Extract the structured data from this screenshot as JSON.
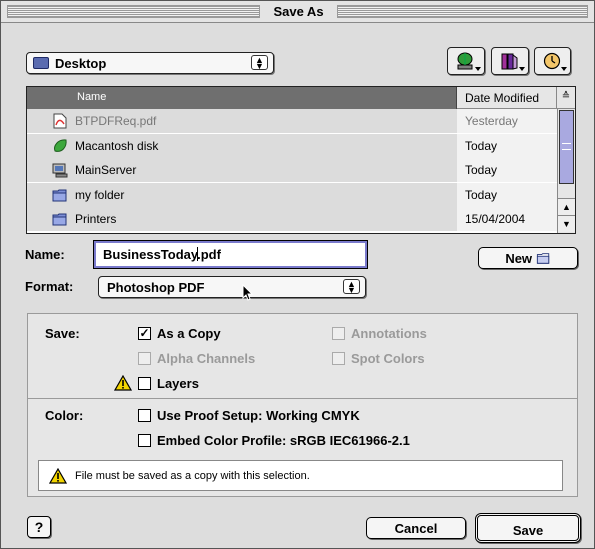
{
  "window": {
    "title": "Save As"
  },
  "location": {
    "selected": "Desktop"
  },
  "toolbar": {
    "icons": [
      "network-icon",
      "favorites-icon",
      "recent-icon"
    ]
  },
  "filelist": {
    "columns": {
      "name": "Name",
      "date": "Date Modified"
    },
    "rows": [
      {
        "name": "BTPDFReq.pdf",
        "date": "Yesterday",
        "icon": "pdf-file-icon",
        "dimmed": true
      },
      {
        "name": "Macantosh disk",
        "date": "Today",
        "icon": "disk-icon",
        "dimmed": false
      },
      {
        "name": "MainServer",
        "date": "Today",
        "icon": "server-icon",
        "dimmed": false
      },
      {
        "name": "my folder",
        "date": "Today",
        "icon": "folder-icon",
        "dimmed": false
      },
      {
        "name": "Printers",
        "date": "15/04/2004",
        "icon": "folder-icon",
        "dimmed": false
      }
    ]
  },
  "name_field": {
    "label": "Name:",
    "value_before_cursor": "BusinessToday",
    "value_after_cursor": ".pdf"
  },
  "new_button": {
    "label": "New"
  },
  "format": {
    "label": "Format:",
    "selected": "Photoshop PDF"
  },
  "save_options": {
    "label": "Save:",
    "as_a_copy": {
      "label": "As a Copy",
      "checked": true,
      "enabled": true
    },
    "annotations": {
      "label": "Annotations",
      "checked": false,
      "enabled": false
    },
    "alpha_channels": {
      "label": "Alpha Channels",
      "checked": false,
      "enabled": false
    },
    "spot_colors": {
      "label": "Spot Colors",
      "checked": false,
      "enabled": false
    },
    "layers": {
      "label": "Layers",
      "checked": false,
      "enabled": true
    }
  },
  "color_options": {
    "label": "Color:",
    "proof_setup": {
      "label": "Use Proof Setup: Working CMYK",
      "checked": false
    },
    "embed_profile": {
      "label": "Embed Color Profile: sRGB IEC61966-2.1",
      "checked": false
    }
  },
  "note": {
    "text": "File must be saved as a copy with this selection."
  },
  "help": {
    "label": "?"
  },
  "buttons": {
    "cancel": "Cancel",
    "save": "Save"
  },
  "colors": {
    "scroll_thumb": "#a9a9e0",
    "header_dark": "#6f6f6f",
    "warning": "#f2d400"
  }
}
